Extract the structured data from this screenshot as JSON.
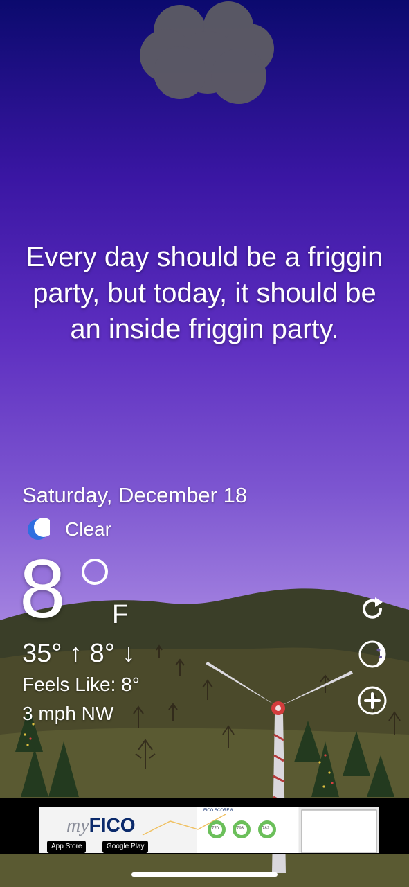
{
  "quote": "Every day should be a friggin party, but today, it should be an inside friggin party.",
  "date": "Saturday, December 18",
  "condition": {
    "icon": "moon-icon",
    "label": "Clear"
  },
  "temperature": {
    "value": "8",
    "unit": "F"
  },
  "high_low": "35° ↑  8° ↓",
  "feels_like": "Feels Like: 8°",
  "wind": "3 mph NW",
  "controls": {
    "refresh_icon": "refresh-icon",
    "theme_icon": "moon-phase-icon",
    "add_icon": "add-circle-icon"
  },
  "ad": {
    "brand_prefix": "my",
    "brand_name": "FICO",
    "app_store": "App Store",
    "google_play": "Google Play",
    "score_label": "FICO SCORE 8",
    "scores": [
      "770",
      "793",
      "782"
    ]
  },
  "colors": {
    "sky_top": "#0b0a6e",
    "sky_bottom": "#c7aef0",
    "moon": "#2f6fe0",
    "hills": "#3f4327"
  }
}
